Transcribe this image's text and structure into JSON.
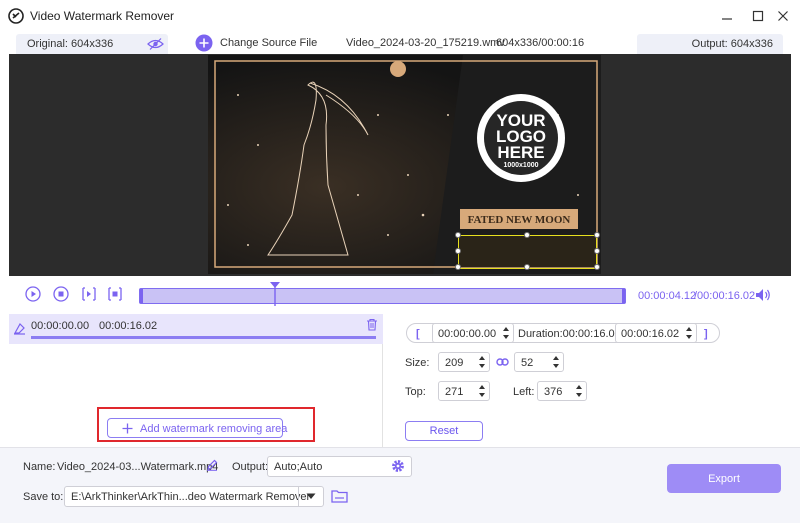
{
  "app": {
    "title": "Video Watermark Remover"
  },
  "toolbar": {
    "original_label": "Original: 604x336",
    "change_source": "Change Source File",
    "filename": "Video_2024-03-20_175219.wmv",
    "meta": "604x336/00:00:16",
    "output_label": "Output: 604x336"
  },
  "video": {
    "logo_lines": [
      "YOUR",
      "LOGO",
      "HERE"
    ],
    "logo_size": "1000x1000",
    "banner_text": "FATED NEW MOON"
  },
  "playback": {
    "current_time": "00:00:04.12",
    "total_time": "/00:00:16.02",
    "progress": 0.28
  },
  "segment": {
    "start": "00:00:00.00",
    "end": "00:00:16.02"
  },
  "add_area": {
    "label": "Add watermark removing area"
  },
  "range": {
    "start": "00:00:00.00",
    "duration": "Duration:00:00:16.02",
    "end": "00:00:16.02",
    "bracket_open": "[",
    "bracket_close": "]"
  },
  "size": {
    "label": "Size:",
    "width": "209",
    "height": "52"
  },
  "position": {
    "top_label": "Top:",
    "top": "271",
    "left_label": "Left:",
    "left": "376"
  },
  "reset": {
    "label": "Reset"
  },
  "output": {
    "name_label": "Name:",
    "name_value": "Video_2024-03...Watermark.mp4",
    "output_label": "Output:",
    "output_value": "Auto;Auto",
    "save_label": "Save to:",
    "save_value": "E:\\ArkThinker\\ArkThin...deo Watermark Remover"
  },
  "export": {
    "label": "Export"
  },
  "colors": {
    "accent": "#7b63f0",
    "accent_light": "#c9c2f5",
    "export_bg": "#9e8cf6",
    "highlight": "#e0282d",
    "gold": "#d7a97a"
  }
}
